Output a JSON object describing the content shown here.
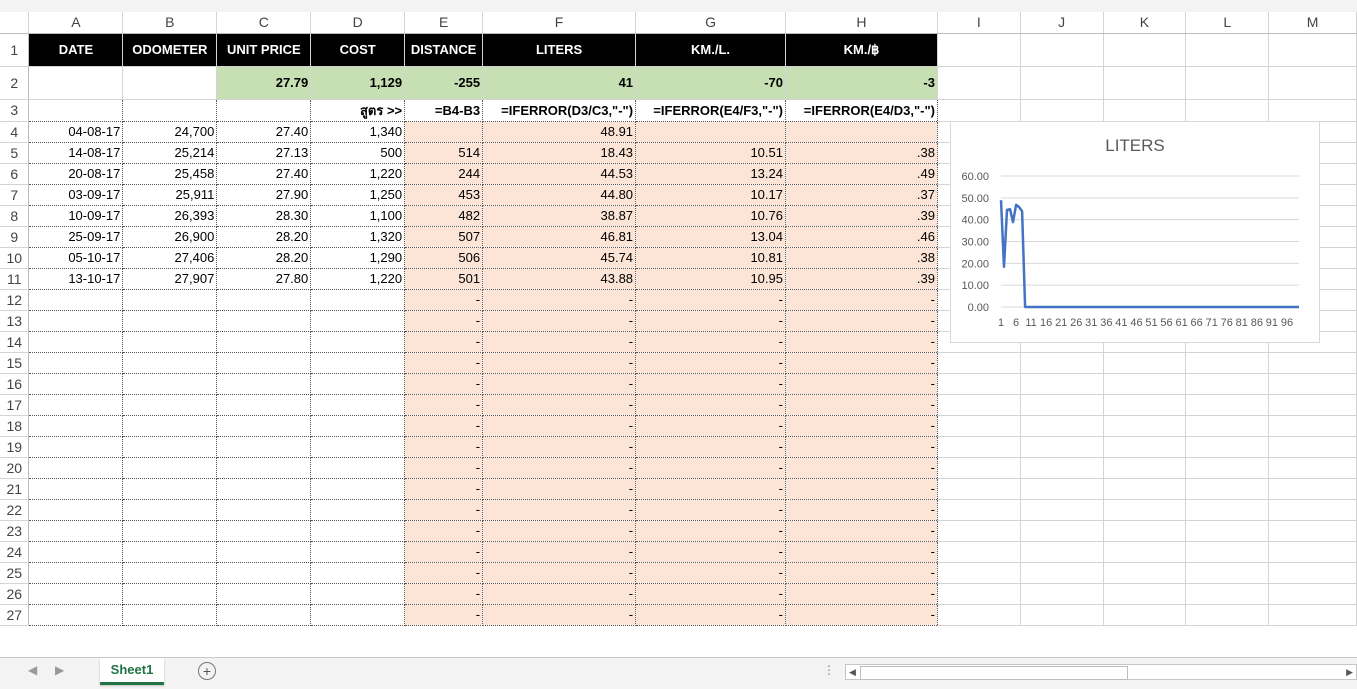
{
  "columns": [
    "A",
    "B",
    "C",
    "D",
    "E",
    "F",
    "G",
    "H",
    "I",
    "J",
    "K",
    "L",
    "M"
  ],
  "header_row": {
    "date": "DATE",
    "odometer": "ODOMETER",
    "unit_price": "UNIT PRICE",
    "cost": "COST",
    "distance": "DISTANCE",
    "liters": "LITERS",
    "km_per_l": "KM./L.",
    "km_per_baht": "KM./฿"
  },
  "summary_row": {
    "unit_price": "27.79",
    "cost": "1,129",
    "distance": "-255",
    "liters": "41",
    "km_per_l": "-70",
    "km_per_baht": "-3"
  },
  "formula_row": {
    "label": "สูตร >>",
    "distance": "=B4-B3",
    "liters": "=IFERROR(D3/C3,\"-\")",
    "km_per_l": "=IFERROR(E4/F3,\"-\")",
    "km_per_baht": "=IFERROR(E4/D3,\"-\")"
  },
  "data_rows": [
    {
      "row": "4",
      "date": "04-08-17",
      "odometer": "24,700",
      "unit_price": "27.40",
      "cost": "1,340",
      "distance": "",
      "liters": "48.91",
      "km_per_l": "",
      "km_per_baht": ""
    },
    {
      "row": "5",
      "date": "14-08-17",
      "odometer": "25,214",
      "unit_price": "27.13",
      "cost": "500",
      "distance": "514",
      "liters": "18.43",
      "km_per_l": "10.51",
      "km_per_baht": ".38"
    },
    {
      "row": "6",
      "date": "20-08-17",
      "odometer": "25,458",
      "unit_price": "27.40",
      "cost": "1,220",
      "distance": "244",
      "liters": "44.53",
      "km_per_l": "13.24",
      "km_per_baht": ".49"
    },
    {
      "row": "7",
      "date": "03-09-17",
      "odometer": "25,911",
      "unit_price": "27.90",
      "cost": "1,250",
      "distance": "453",
      "liters": "44.80",
      "km_per_l": "10.17",
      "km_per_baht": ".37"
    },
    {
      "row": "8",
      "date": "10-09-17",
      "odometer": "26,393",
      "unit_price": "28.30",
      "cost": "1,100",
      "distance": "482",
      "liters": "38.87",
      "km_per_l": "10.76",
      "km_per_baht": ".39"
    },
    {
      "row": "9",
      "date": "25-09-17",
      "odometer": "26,900",
      "unit_price": "28.20",
      "cost": "1,320",
      "distance": "507",
      "liters": "46.81",
      "km_per_l": "13.04",
      "km_per_baht": ".46"
    },
    {
      "row": "10",
      "date": "05-10-17",
      "odometer": "27,406",
      "unit_price": "28.20",
      "cost": "1,290",
      "distance": "506",
      "liters": "45.74",
      "km_per_l": "10.81",
      "km_per_baht": ".38"
    },
    {
      "row": "11",
      "date": "13-10-17",
      "odometer": "27,907",
      "unit_price": "27.80",
      "cost": "1,220",
      "distance": "501",
      "liters": "43.88",
      "km_per_l": "10.95",
      "km_per_baht": ".39"
    }
  ],
  "empty_rows": [
    "12",
    "13",
    "14",
    "15",
    "16",
    "17",
    "18",
    "19",
    "20",
    "21",
    "22",
    "23",
    "24",
    "25",
    "26",
    "27"
  ],
  "dash": "-",
  "sheet_tab": "Sheet1",
  "colors": {
    "header_bg": "#000000",
    "summary_bg": "#c6e0b4",
    "pink_bg": "#fce4d6",
    "line": "#4472c4",
    "tab_green": "#217346"
  },
  "chart_data": {
    "type": "line",
    "title": "LITERS",
    "x_tick_labels": [
      "1",
      "6",
      "11",
      "16",
      "21",
      "26",
      "31",
      "36",
      "41",
      "46",
      "51",
      "56",
      "61",
      "66",
      "71",
      "76",
      "81",
      "86",
      "91",
      "96"
    ],
    "y_tick_labels": [
      "0.00",
      "10.00",
      "20.00",
      "30.00",
      "40.00",
      "50.00",
      "60.00"
    ],
    "ylim": [
      0,
      60
    ],
    "x_count": 100,
    "series": [
      {
        "values": [
          48.91,
          18.43,
          44.53,
          44.8,
          38.87,
          46.81,
          45.74,
          43.88
        ]
      }
    ],
    "remaining_value": 0,
    "grid": true
  }
}
